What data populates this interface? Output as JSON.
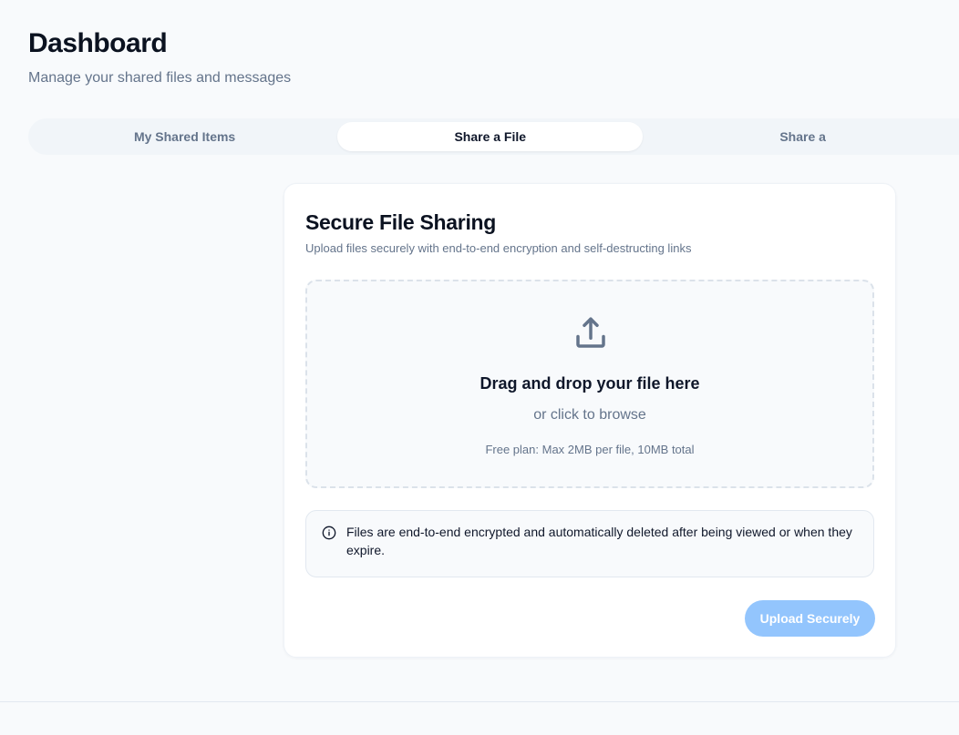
{
  "header": {
    "title": "Dashboard",
    "subtitle": "Manage your shared files and messages"
  },
  "tabs": [
    {
      "label": "My Shared Items",
      "active": false
    },
    {
      "label": "Share a File",
      "active": true
    },
    {
      "label": "Share a",
      "active": false
    }
  ],
  "card": {
    "title": "Secure File Sharing",
    "description": "Upload files securely with end-to-end encryption and self-destructing links",
    "dropzone": {
      "icon": "upload-icon",
      "title": "Drag and drop your file here",
      "subtitle": "or click to browse",
      "note": "Free plan: Max 2MB per file, 10MB total"
    },
    "alert": {
      "icon": "info-icon",
      "text": "Files are end-to-end encrypted and automatically deleted after being viewed or when they expire."
    },
    "upload_button_label": "Upload Securely"
  },
  "colors": {
    "background": "#f8fafc",
    "primary_disabled": "#93c5fd",
    "muted_text": "#64748b",
    "heading_text": "#0b1220"
  }
}
